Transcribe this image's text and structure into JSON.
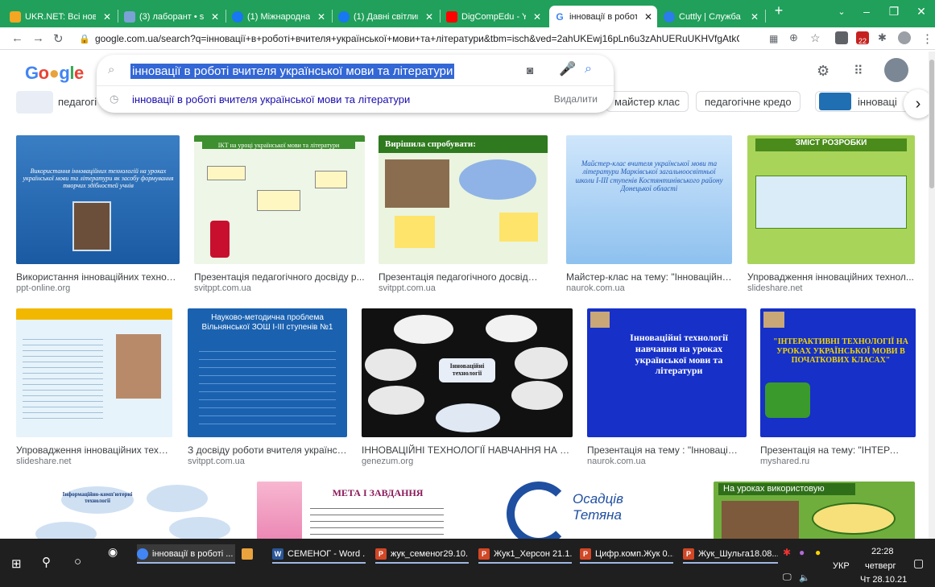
{
  "browser": {
    "tabs": [
      {
        "title": "UKR.NET: Всі нови",
        "color": "#f5a623"
      },
      {
        "title": "(3) лаборант • sum",
        "color": "#7aa2d6"
      },
      {
        "title": "(1) Міжнародна о",
        "color": "#1877f2"
      },
      {
        "title": "(1) Давні світлини",
        "color": "#1877f2"
      },
      {
        "title": "DigCompEdu - You",
        "color": "#ff0000"
      },
      {
        "title": "інновації в роботі",
        "color": "#4285f4"
      },
      {
        "title": "Cuttly | Служба зм",
        "color": "#2b7de9"
      }
    ],
    "new_tab": "+",
    "url": "google.com.ua/search?q=інновації+в+роботі+вчителя+української+мови+та+літератури&tbm=isch&ved=2ahUKEwj16pLn6u3zAhUERuUKHVfgAtkQ2-cCegQIA...",
    "ext_badge": "22"
  },
  "search": {
    "logo": "Google",
    "query": "інновації в роботі вчителя української мови та літератури",
    "suggestion": "інновації в роботі вчителя української мови та літератури",
    "delete_label": "Видалити"
  },
  "chips": [
    {
      "label": "педагогі"
    },
    {
      "label": "майстер клас"
    },
    {
      "label": "педагогічне кредо"
    },
    {
      "label": "інноваці"
    }
  ],
  "results": [
    {
      "title": "Використання інноваційних технол...",
      "source": "ppt-online.org",
      "thumb": "Використання інноваційних технологій на уроках української мови та літератури як засобу формування творчих здібностей учнів"
    },
    {
      "title": "Презентація педагогічного досвіду р...",
      "source": "svitppt.com.ua",
      "thumb": "ІКТ на уроці української мови та літератури"
    },
    {
      "title": "Презентація педагогічного досвіду р...",
      "source": "svitppt.com.ua",
      "thumb": "Вирішила спробувати:"
    },
    {
      "title": "Майстер-клас на тему: \"Інноваційні те...",
      "source": "naurok.com.ua",
      "thumb": "Майстер-клас вчителя української мови та літератури Марківської загальноосвітньої школи І-ІІІ ступенів Костянтинівського району Донецької області"
    },
    {
      "title": "Упровадження інноваційних технол...",
      "source": "slideshare.net",
      "thumb": "ЗМІСТ РОЗРОБКИ"
    },
    {
      "title": "Упровадження інноваційних техно...",
      "source": "slideshare.net",
      "thumb": "НАУКОВО-МЕТОДИЧНА РОЗРОБКА"
    },
    {
      "title": "З досвіду роботи вчителя українсь...",
      "source": "svitppt.com.ua",
      "thumb": "Науково-методична проблема Вільнянської ЗОШ І-ІІІ ступенів №1"
    },
    {
      "title": "ІННОВАЦІЙНІ ТЕХНОЛОГІЇ НАВЧАННЯ НА УРОК...",
      "source": "genezum.org",
      "thumb": "Інноваційні технології"
    },
    {
      "title": "Презентація на тему : \"Інноваційні ...",
      "source": "naurok.com.ua",
      "thumb": "Інноваційні технології навчання на уроках української мови та літератури"
    },
    {
      "title": "Презентація на тему: \"ІНТЕРАКТИ...",
      "source": "myshared.ru",
      "thumb": "\"ІНТЕРАКТИВНІ ТЕХНОЛОГІЇ НА УРОКАХ УКРАЇНСЬКОЇ МОВИ В ПОЧАТКОВИХ КЛАСАХ\""
    },
    {
      "title": "",
      "source": "",
      "thumb": "Інформаційно-комп'ютерні технології"
    },
    {
      "title": "",
      "source": "",
      "thumb": "МЕТА І ЗАВДАННЯ"
    },
    {
      "title": "",
      "source": "",
      "thumb": "Осадців Тетяна"
    },
    {
      "title": "",
      "source": "",
      "thumb": "На уроках використовую"
    }
  ],
  "taskbar": {
    "items": [
      {
        "label": "інновації в роботі ...",
        "color": "#4285f4",
        "glyph": "G"
      },
      {
        "label": "",
        "color": "#e8a33d",
        "glyph": ""
      },
      {
        "label": "СЕМЕНОГ - Word ...",
        "color": "#2b579a",
        "glyph": "W"
      },
      {
        "label": "жук_семеног29.10...",
        "color": "#d24726",
        "glyph": "P"
      },
      {
        "label": "Жук1_Херсон 21.1...",
        "color": "#d24726",
        "glyph": "P"
      },
      {
        "label": "Цифр.комп.Жук 0...",
        "color": "#d24726",
        "glyph": "P"
      },
      {
        "label": "Жук_Шульга18.08...",
        "color": "#d24726",
        "glyph": "P"
      }
    ],
    "lang": "УКР",
    "time": "22:28",
    "day": "четверг",
    "date": "Чт 28.10.21"
  }
}
